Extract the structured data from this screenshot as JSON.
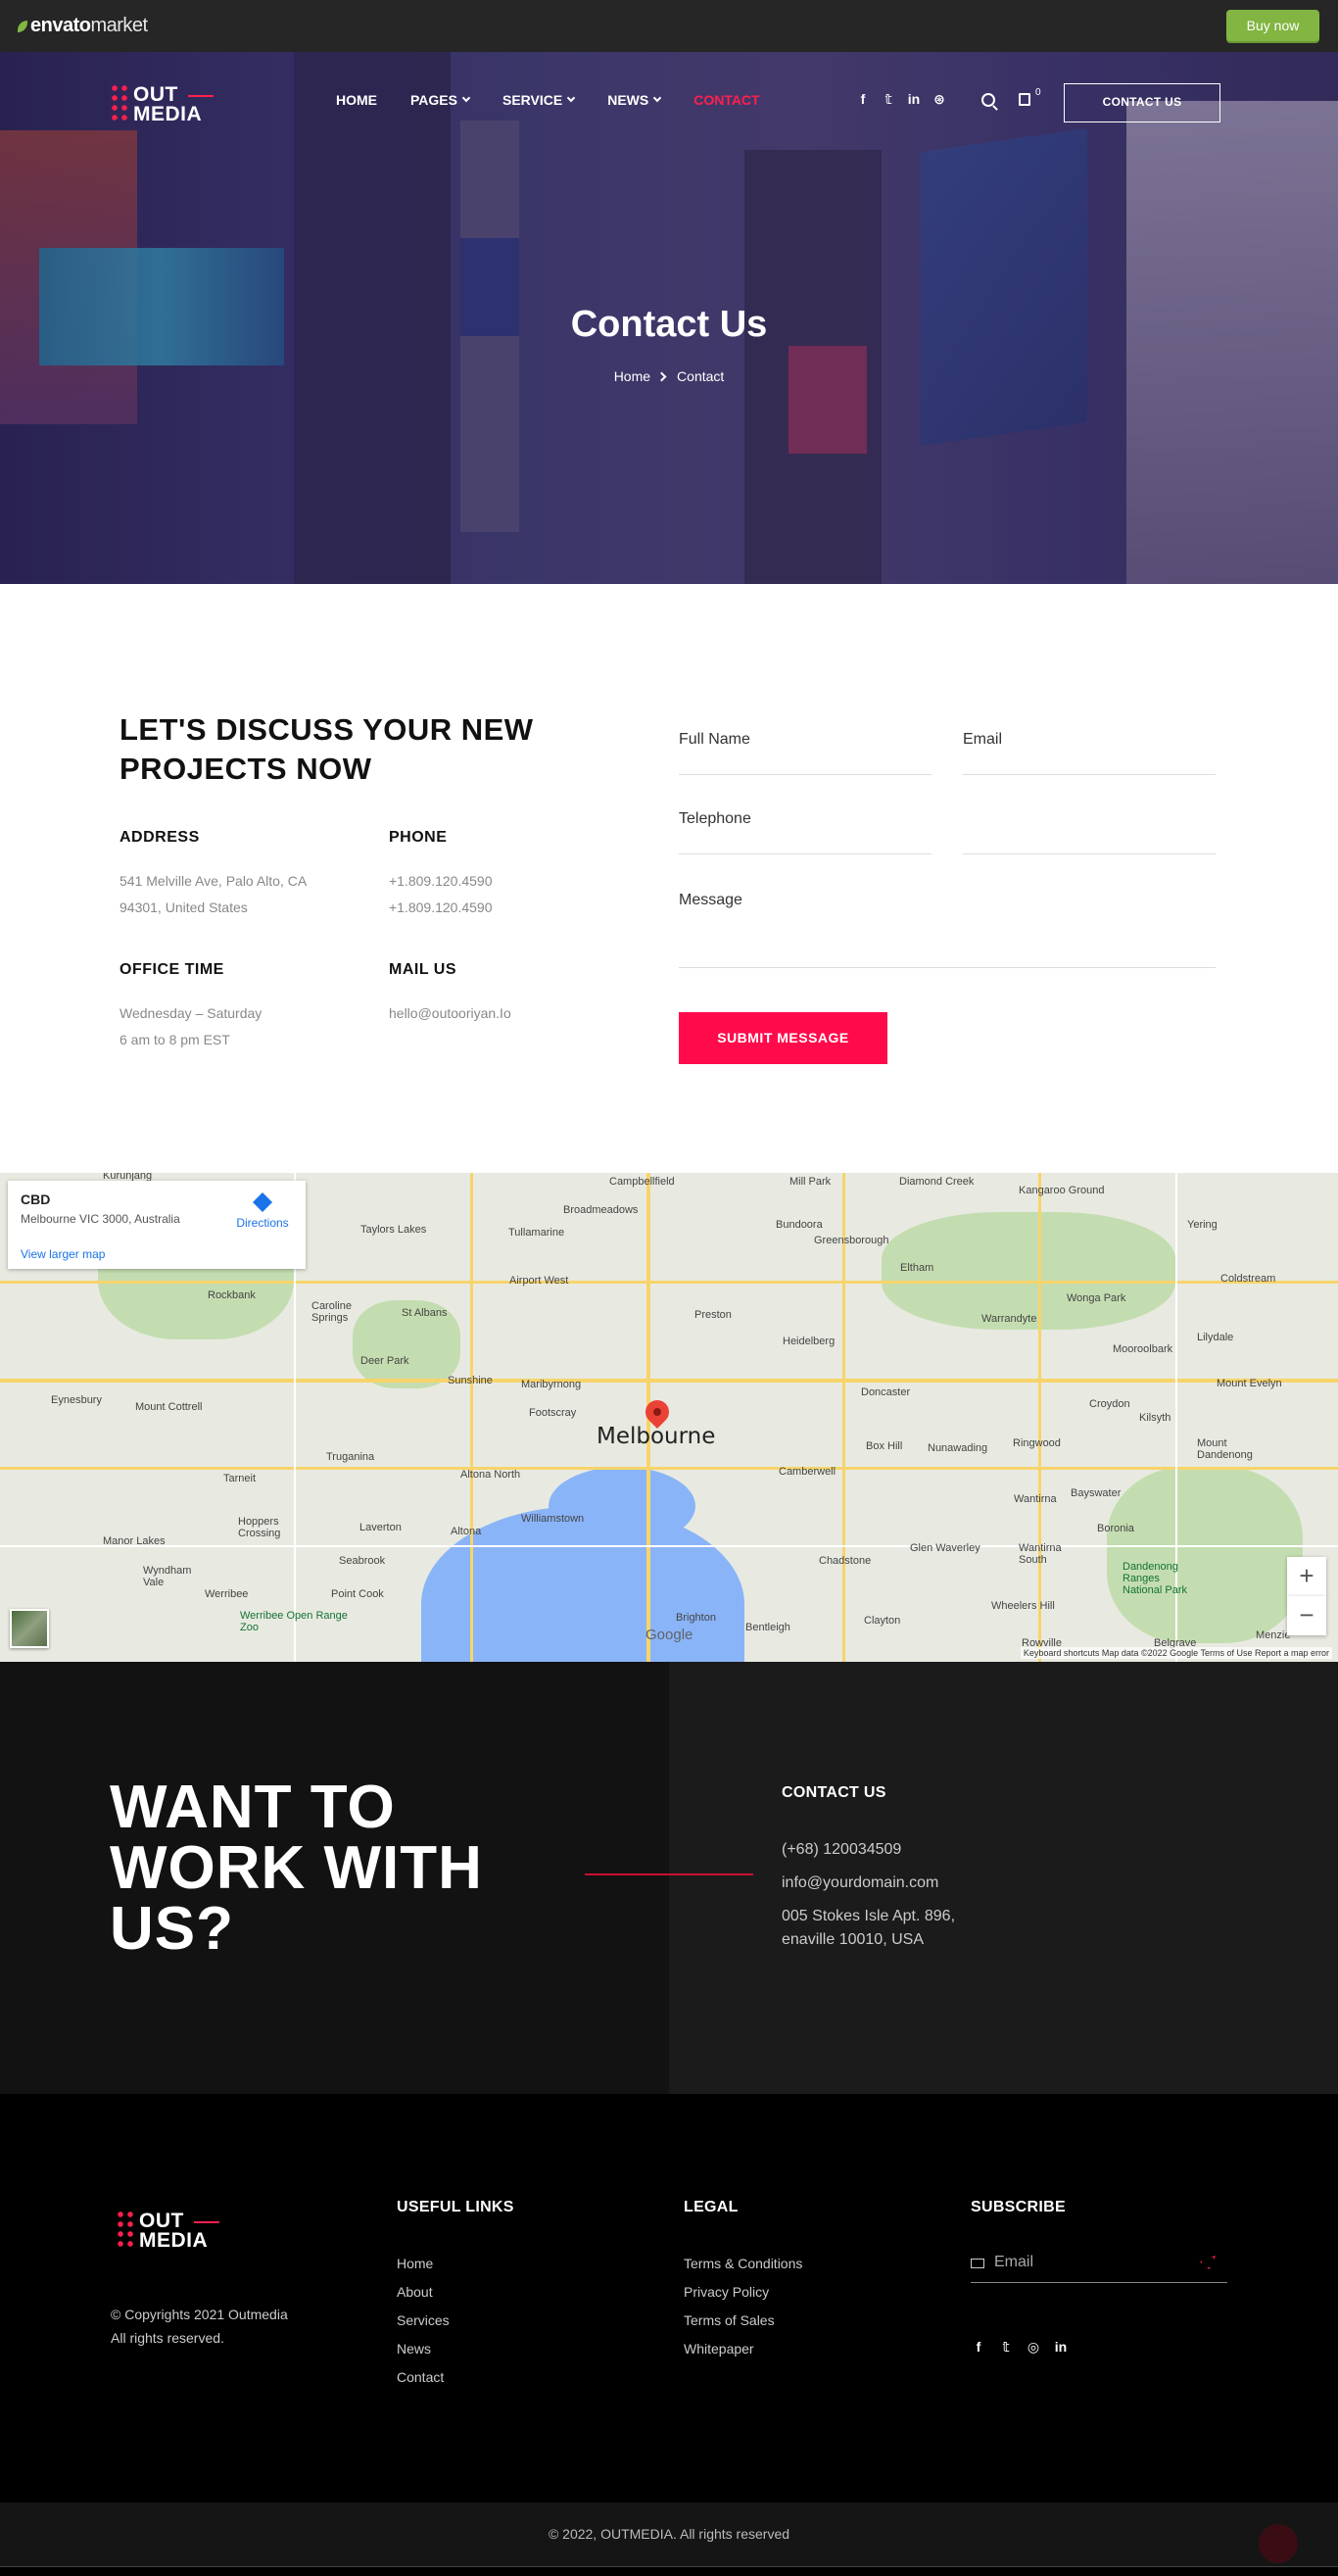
{
  "envato": {
    "logo_brand": "envato",
    "logo_suffix": "market",
    "buy_label": "Buy now"
  },
  "header": {
    "logo_line1": "OUT",
    "logo_line2": "MEDIA",
    "nav": [
      {
        "label": "HOME"
      },
      {
        "label": "PAGES"
      },
      {
        "label": "SERVICE"
      },
      {
        "label": "NEWS"
      },
      {
        "label": "CONTACT"
      }
    ],
    "social_icons": [
      "facebook-icon",
      "twitter-icon",
      "linkedin-icon",
      "dribbble-icon"
    ],
    "social_glyphs": [
      "f",
      "𝕥",
      "in",
      "⊛"
    ],
    "cart_count": "0",
    "cta_label": "CONTACT US"
  },
  "hero": {
    "title": "Contact Us",
    "crumb_home": "Home",
    "crumb_current": "Contact"
  },
  "contact": {
    "heading": "LET'S DISCUSS YOUR NEW PROJECTS NOW",
    "address_title": "ADDRESS",
    "address_l1": "541 Melville Ave, Palo Alto, CA",
    "address_l2": "94301, United States",
    "phone_title": "PHONE",
    "phone_l1": "+1.809.120.4590",
    "phone_l2": "+1.809.120.4590",
    "office_title": "OFFICE TIME",
    "office_l1": "Wednesday – Saturday",
    "office_l2": "6 am to 8 pm EST",
    "mail_title": "MAIL US",
    "mail_l1": "hello@outooriyan.Io",
    "form": {
      "fullname": "Full Name",
      "email": "Email",
      "telephone": "Telephone",
      "message": "Message",
      "submit": "SUBMIT MESSAGE"
    }
  },
  "map": {
    "card_title": "CBD",
    "card_sub": "Melbourne VIC 3000, Australia",
    "card_link": "View larger map",
    "directions": "Directions",
    "city": "Melbourne",
    "google": "Google",
    "footer_text": "Keyboard shortcuts   Map data ©2022 Google   Terms of Use   Report a map error",
    "labels": [
      "Kurunjang",
      "Campbellfield",
      "Mill Park",
      "Diamond Creek",
      "Kangaroo Ground",
      "Yering",
      "Taylors Lakes",
      "Broadmeadows",
      "Tullamarine",
      "Bundoora",
      "Greensborough",
      "Eltham",
      "Rockbank",
      "Airport West",
      "Coldstream",
      "Wonga Park",
      "Caroline Springs",
      "St Albans",
      "Preston",
      "Warrandyte",
      "Heidelberg",
      "Mooroolbark",
      "Lilydale",
      "Deer Park",
      "Sunshine",
      "Maribyrnong",
      "Doncaster",
      "Mount Evelyn",
      "Eynesbury",
      "Mount Cottrell",
      "Footscray",
      "Croydon",
      "Kilsyth",
      "Truganina",
      "Box Hill",
      "Nunawading",
      "Ringwood",
      "Mount Dandenong",
      "Tarneit",
      "Altona North",
      "Camberwell",
      "Hoppers Crossing",
      "Laverton",
      "Williamstown",
      "Wantirna",
      "Bayswater",
      "Manor Lakes",
      "Altona",
      "Boronia",
      "Chadstone",
      "Glen Waverley",
      "Wantirna South",
      "Wyndham Vale",
      "Seabrook",
      "Werribee",
      "Point Cook",
      "Werribee Open Range Zoo",
      "Dandenong Ranges National Park",
      "Brighton",
      "Bentleigh",
      "Clayton",
      "Wheelers Hill",
      "Rowville",
      "Belgrave",
      "Menzie"
    ]
  },
  "cta": {
    "big_l1": "WANT TO",
    "big_l2": "WORK WITH",
    "big_l3": "US?",
    "title": "CONTACT US",
    "phone": "(+68) 120034509",
    "email": "info@yourdomain.com",
    "addr_l1": "005 Stokes Isle Apt. 896,",
    "addr_l2": "enaville 10010, USA"
  },
  "footer": {
    "copy_l1": "© Copyrights 2021 Outmedia",
    "copy_l2": "All rights reserved.",
    "useful_title": "USEFUL LINKS",
    "useful": [
      "Home",
      "About",
      "Services",
      "News",
      "Contact"
    ],
    "legal_title": "LEGAL",
    "legal": [
      "Terms & Conditions",
      "Privacy Policy",
      "Terms of Sales",
      "Whitepaper"
    ],
    "subscribe_title": "SUBSCRIBE",
    "email_placeholder": "Email",
    "social_glyphs": [
      "f",
      "𝕥",
      "◎",
      "in"
    ],
    "bottom": "© 2022, OUTMEDIA. All rights reserved"
  },
  "colors": {
    "accent": "#ff0a4b",
    "envato_green": "#82b541",
    "dark": "#121212"
  }
}
